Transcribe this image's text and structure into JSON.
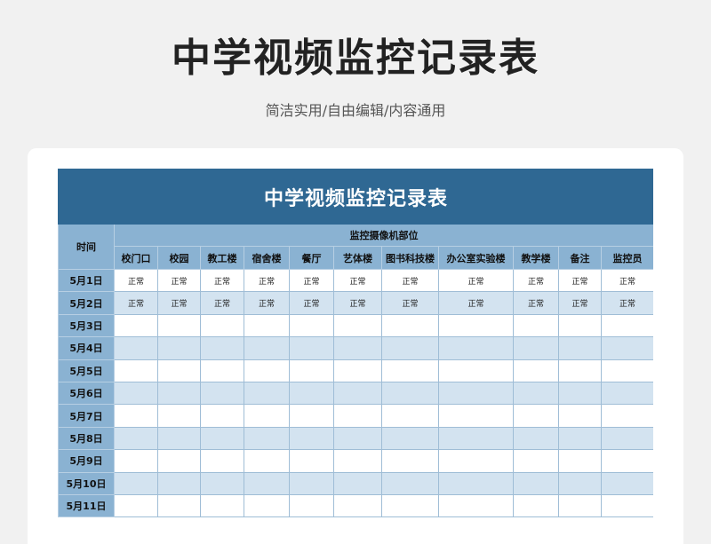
{
  "page": {
    "title": "中学视频监控记录表",
    "subtitle": "简洁实用/自由编辑/内容通用"
  },
  "sheet": {
    "title": "中学视频监控记录表",
    "time_header": "时间",
    "group_header": "监控摄像机部位",
    "columns": [
      "校门口",
      "校园",
      "教工楼",
      "宿舍楼",
      "餐厅",
      "艺体楼",
      "图书科技楼",
      "办公室实验楼",
      "教学楼",
      "备注",
      "监控员"
    ],
    "rows": [
      {
        "date": "5月1日",
        "cells": [
          "正常",
          "正常",
          "正常",
          "正常",
          "正常",
          "正常",
          "正常",
          "正常",
          "正常",
          "正常",
          "正常"
        ]
      },
      {
        "date": "5月2日",
        "cells": [
          "正常",
          "正常",
          "正常",
          "正常",
          "正常",
          "正常",
          "正常",
          "正常",
          "正常",
          "正常",
          "正常"
        ]
      },
      {
        "date": "5月3日",
        "cells": [
          "",
          "",
          "",
          "",
          "",
          "",
          "",
          "",
          "",
          "",
          ""
        ]
      },
      {
        "date": "5月4日",
        "cells": [
          "",
          "",
          "",
          "",
          "",
          "",
          "",
          "",
          "",
          "",
          ""
        ]
      },
      {
        "date": "5月5日",
        "cells": [
          "",
          "",
          "",
          "",
          "",
          "",
          "",
          "",
          "",
          "",
          ""
        ]
      },
      {
        "date": "5月6日",
        "cells": [
          "",
          "",
          "",
          "",
          "",
          "",
          "",
          "",
          "",
          "",
          ""
        ]
      },
      {
        "date": "5月7日",
        "cells": [
          "",
          "",
          "",
          "",
          "",
          "",
          "",
          "",
          "",
          "",
          ""
        ]
      },
      {
        "date": "5月8日",
        "cells": [
          "",
          "",
          "",
          "",
          "",
          "",
          "",
          "",
          "",
          "",
          ""
        ]
      },
      {
        "date": "5月9日",
        "cells": [
          "",
          "",
          "",
          "",
          "",
          "",
          "",
          "",
          "",
          "",
          ""
        ]
      },
      {
        "date": "5月10日",
        "cells": [
          "",
          "",
          "",
          "",
          "",
          "",
          "",
          "",
          "",
          "",
          ""
        ]
      },
      {
        "date": "5月11日",
        "cells": [
          "",
          "",
          "",
          "",
          "",
          "",
          "",
          "",
          "",
          "",
          ""
        ]
      }
    ]
  },
  "colors": {
    "title_band": "#2f6893",
    "header_fill": "#8ab2d2",
    "stripe_fill": "#d3e3f0",
    "page_background": "#f1f1f1"
  }
}
